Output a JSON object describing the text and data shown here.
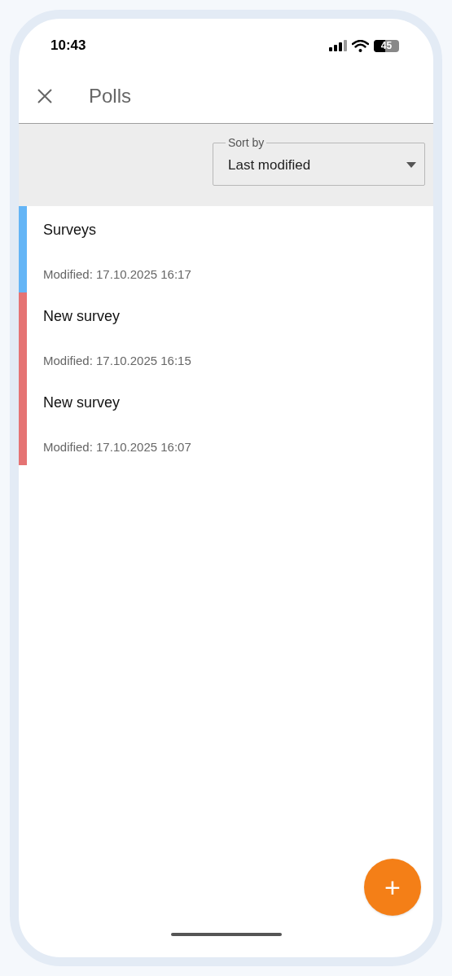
{
  "status_bar": {
    "time": "10:43",
    "battery": "45"
  },
  "header": {
    "title": "Polls"
  },
  "sort": {
    "label": "Sort by",
    "value": "Last modified"
  },
  "polls": [
    {
      "title": "Surveys",
      "modified": "Modified: 17.10.2025 16:17",
      "color": "#64b5f6"
    },
    {
      "title": "New survey",
      "modified": "Modified: 17.10.2025 16:15",
      "color": "#e57373"
    },
    {
      "title": "New survey",
      "modified": "Modified: 17.10.2025 16:07",
      "color": "#e57373"
    }
  ],
  "fab": {
    "label": "+"
  }
}
